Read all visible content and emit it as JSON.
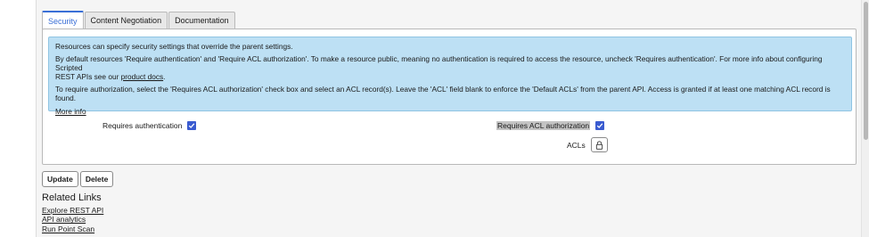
{
  "tabs": [
    {
      "label": "Security",
      "active": true
    },
    {
      "label": "Content Negotiation",
      "active": false
    },
    {
      "label": "Documentation",
      "active": false
    }
  ],
  "info": {
    "line1": "Resources can specify security settings that override the parent settings.",
    "line2a": "By default resources 'Require authentication' and 'Require ACL authorization'. To make a resource public, meaning no authentication is required to access the resource, uncheck 'Requires authentication'. For more info about configuring Scripted",
    "line2b": "REST APIs see our ",
    "product_docs_link": "product docs",
    "line2_end": ".",
    "line3": "To require authorization, select the 'Requires ACL authorization' check box and select an ACL record(s). Leave the 'ACL' field blank to enforce the 'Default ACLs' from the parent API. Access is granted if at least one matching ACL record is found.",
    "more_info_link": "More info"
  },
  "fields": {
    "requires_authentication": {
      "label": "Requires authentication",
      "checked": true
    },
    "requires_acl_authorization": {
      "label": "Requires ACL authorization",
      "checked": true
    },
    "acls": {
      "label": "ACLs",
      "icon": "lock-icon"
    }
  },
  "buttons": {
    "update": "Update",
    "delete": "Delete"
  },
  "related": {
    "title": "Related Links",
    "links": [
      "Explore REST API",
      "API analytics",
      "Run Point Scan"
    ]
  },
  "colors": {
    "accent": "#3a6fd6",
    "checkbox": "#3a5bd0",
    "info_background": "#bde0f4"
  }
}
